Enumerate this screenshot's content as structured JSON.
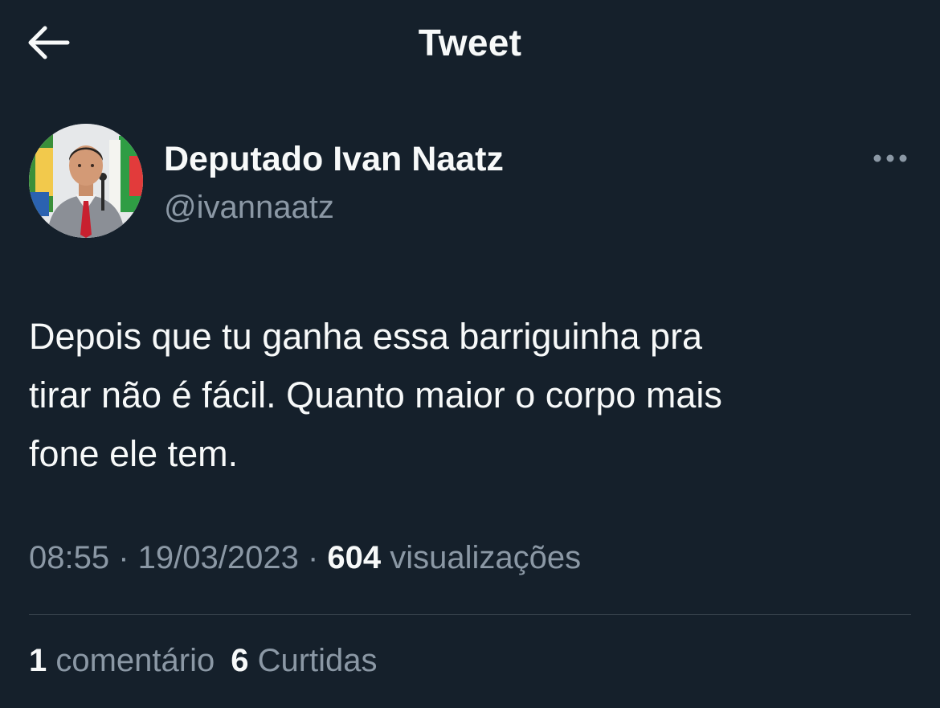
{
  "header": {
    "title": "Tweet",
    "back_icon": "arrow-left-icon"
  },
  "author": {
    "display_name": "Deputado Ivan Naatz",
    "handle": "@ivannaatz",
    "avatar_icon": "profile-photo",
    "more_icon": "more-horizontal-icon"
  },
  "tweet": {
    "lines": [
      "Depois que tu ganha essa barriguinha pra",
      "tirar não é fácil. Quanto maior o corpo mais",
      "fone ele tem."
    ]
  },
  "meta": {
    "time": "08:55",
    "sep1": " · ",
    "date": "19/03/2023",
    "sep2": " · ",
    "views_count": "604",
    "views_label": " visualizações"
  },
  "stats": {
    "comments_count": "1",
    "comments_label": " comentário",
    "likes_count": "6",
    "likes_label": " Curtidas"
  },
  "colors": {
    "background": "#15202b",
    "primary_text": "#f7f9f9",
    "secondary_text": "#8b98a5",
    "divider": "#38444d"
  }
}
